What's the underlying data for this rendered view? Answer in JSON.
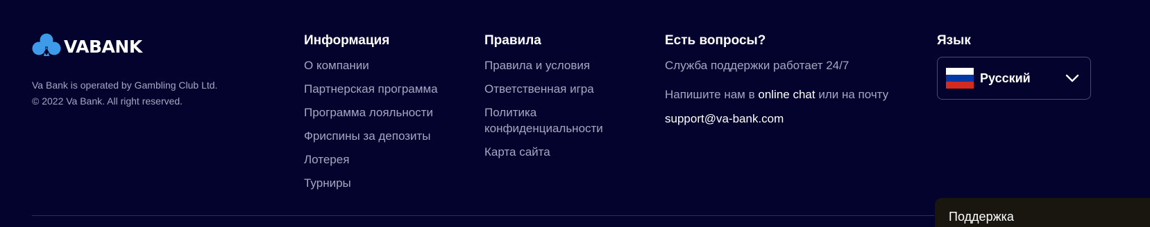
{
  "brand": {
    "logo_text": "VABANK",
    "operated_by": "Va Bank is operated by Gambling Club Ltd.",
    "copyright": "© 2022 Va Bank. All right reserved.",
    "logo_color": "#3d9be9"
  },
  "info": {
    "title": "Информация",
    "items": [
      "О компании",
      "Партнерская программа",
      "Программа лояльности",
      "Фриспины за депозиты",
      "Лотерея",
      "Турниры"
    ]
  },
  "rules": {
    "title": "Правила",
    "items": [
      "Правила и условия",
      "Ответственная игра",
      "Политика конфиденциальности",
      "Карта сайта"
    ]
  },
  "contact": {
    "title": "Есть вопросы?",
    "hours": "Служба поддержки работает 24/7",
    "write_prefix": "Напишите нам в",
    "chat_link": "online chat",
    "write_suffix": "или на почту",
    "email": "support@va-bank.com"
  },
  "language": {
    "title": "Язык",
    "selected": "Русский",
    "flag_icon": "russia-flag-icon",
    "chevron_icon": "chevron-down-icon"
  },
  "support_tab": {
    "label": "Поддержка"
  },
  "colors": {
    "background": "#03032e",
    "muted_text": "#a6a6c2",
    "support_tab_bg": "#18160f"
  }
}
